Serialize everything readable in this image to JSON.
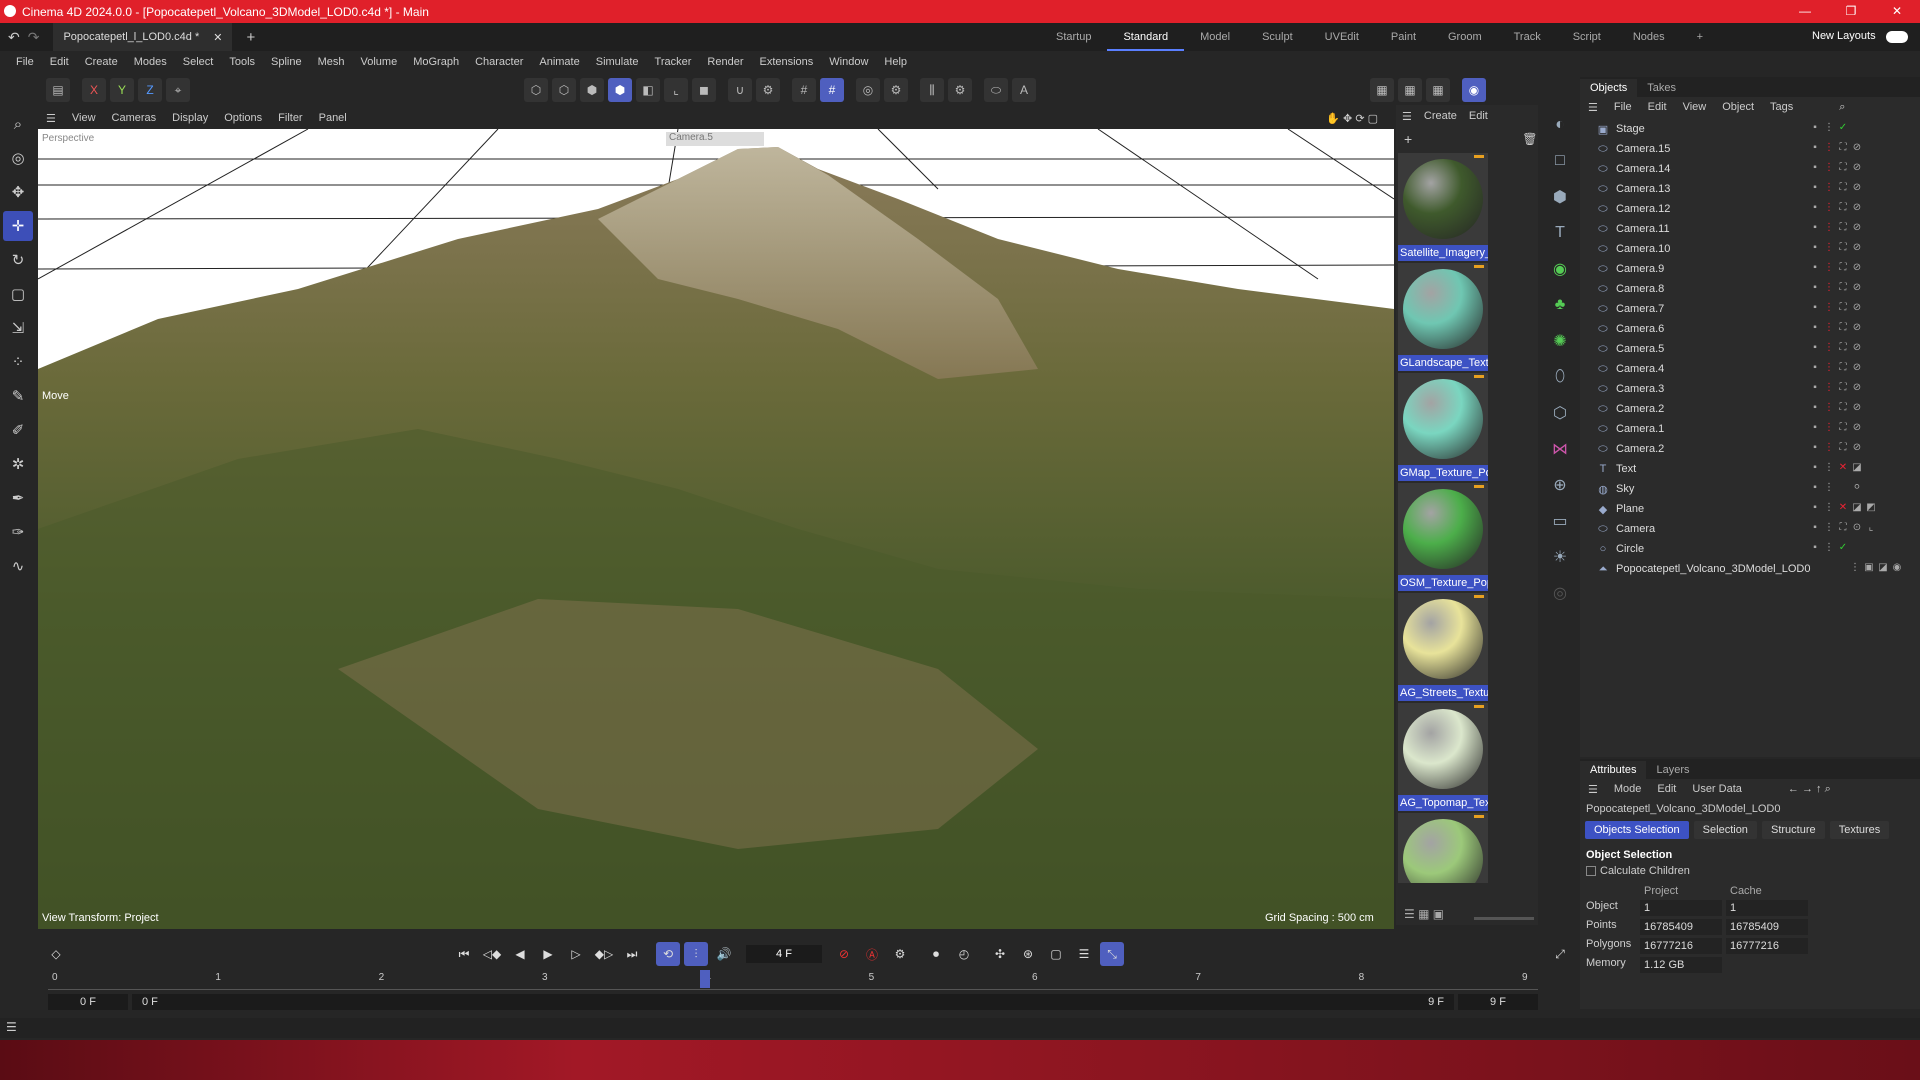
{
  "window": {
    "title": "Cinema 4D 2024.0.0 - [Popocatepetl_Volcano_3DModel_LOD0.c4d *] - Main",
    "controls": [
      "—",
      "❐",
      "✕"
    ]
  },
  "tabs": {
    "document": "Popocatepetl_l_LOD0.c4d *",
    "layouts": [
      "Startup",
      "Standard",
      "Model",
      "Sculpt",
      "UVEdit",
      "Paint",
      "Groom",
      "Track",
      "Script",
      "Nodes"
    ],
    "active_layout": "Standard",
    "new_layouts": "New Layouts"
  },
  "menu": [
    "File",
    "Edit",
    "Create",
    "Modes",
    "Select",
    "Tools",
    "Spline",
    "Mesh",
    "Volume",
    "MoGraph",
    "Character",
    "Animate",
    "Simulate",
    "Tracker",
    "Render",
    "Extensions",
    "Window",
    "Help"
  ],
  "toolbar": {
    "axes": [
      "X",
      "Y",
      "Z"
    ]
  },
  "viewport": {
    "menu": [
      "View",
      "Cameras",
      "Display",
      "Options",
      "Filter",
      "Panel"
    ],
    "projection": "Perspective",
    "camera": "Camera.5",
    "tool_label": "Move",
    "view_transform": "View Transform: Project",
    "grid_spacing": "Grid Spacing : 500 cm"
  },
  "materials": {
    "menu": [
      "Create",
      "Edit"
    ],
    "items": [
      {
        "name": "Satellite_Imagery_",
        "color": "#3f5a2c"
      },
      {
        "name": "GLandscape_Textu",
        "color": "#6fc7b2"
      },
      {
        "name": "GMap_Texture_Po",
        "color": "#7ad6c0"
      },
      {
        "name": "OSM_Texture_Pop",
        "color": "#4cae4a"
      },
      {
        "name": "AG_Streets_Textur",
        "color": "#e8e39a"
      },
      {
        "name": "AG_Topomap_Text",
        "color": "#dbe7cc"
      },
      {
        "name": "",
        "color": "#9cc97a"
      }
    ]
  },
  "objects": {
    "tabs": [
      "Objects",
      "Takes"
    ],
    "menu": [
      "File",
      "Edit",
      "View",
      "Object",
      "Tags"
    ],
    "rows": [
      {
        "name": "Stage",
        "icon": "stage-icon"
      },
      {
        "name": "Camera.15",
        "icon": "camera-icon"
      },
      {
        "name": "Camera.14",
        "icon": "camera-icon"
      },
      {
        "name": "Camera.13",
        "icon": "camera-icon"
      },
      {
        "name": "Camera.12",
        "icon": "camera-icon"
      },
      {
        "name": "Camera.11",
        "icon": "camera-icon"
      },
      {
        "name": "Camera.10",
        "icon": "camera-icon"
      },
      {
        "name": "Camera.9",
        "icon": "camera-icon"
      },
      {
        "name": "Camera.8",
        "icon": "camera-icon"
      },
      {
        "name": "Camera.7",
        "icon": "camera-icon"
      },
      {
        "name": "Camera.6",
        "icon": "camera-icon"
      },
      {
        "name": "Camera.5",
        "icon": "camera-icon"
      },
      {
        "name": "Camera.4",
        "icon": "camera-icon"
      },
      {
        "name": "Camera.3",
        "icon": "camera-icon"
      },
      {
        "name": "Camera.2",
        "icon": "camera-icon"
      },
      {
        "name": "Camera.1",
        "icon": "camera-icon"
      },
      {
        "name": "Camera.2",
        "icon": "camera-icon"
      },
      {
        "name": "Text",
        "icon": "text-icon"
      },
      {
        "name": "Sky",
        "icon": "sky-icon"
      },
      {
        "name": "Plane",
        "icon": "plane-icon"
      },
      {
        "name": "Camera",
        "icon": "camera-icon"
      },
      {
        "name": "Circle",
        "icon": "circle-icon"
      },
      {
        "name": "Popocatepetl_Volcano_3DModel_LOD0",
        "icon": "mesh-icon"
      }
    ]
  },
  "attributes": {
    "tabs": [
      "Attributes",
      "Layers"
    ],
    "menu": [
      "Mode",
      "Edit",
      "User Data"
    ],
    "object_name": "Popocatepetl_Volcano_3DModel_LOD0",
    "sections": [
      "Objects Selection",
      "Selection",
      "Structure",
      "Textures"
    ],
    "heading": "Object Selection",
    "checkbox_label": "Calculate Children",
    "columns": [
      "Project",
      "Cache"
    ],
    "rows": [
      {
        "label": "Object",
        "project": "1",
        "cache": "1"
      },
      {
        "label": "Points",
        "project": "16785409",
        "cache": "16785409"
      },
      {
        "label": "Polygons",
        "project": "16777216",
        "cache": "16777216"
      },
      {
        "label": "Memory",
        "project": "1.12 GB",
        "cache": ""
      }
    ]
  },
  "timeline": {
    "current_frame": "4 F",
    "ticks": [
      "0",
      "1",
      "2",
      "3",
      "4",
      "5",
      "6",
      "7",
      "8",
      "9"
    ],
    "start": "0 F",
    "min": "0 F",
    "max": "9 F",
    "end": "9 F"
  }
}
